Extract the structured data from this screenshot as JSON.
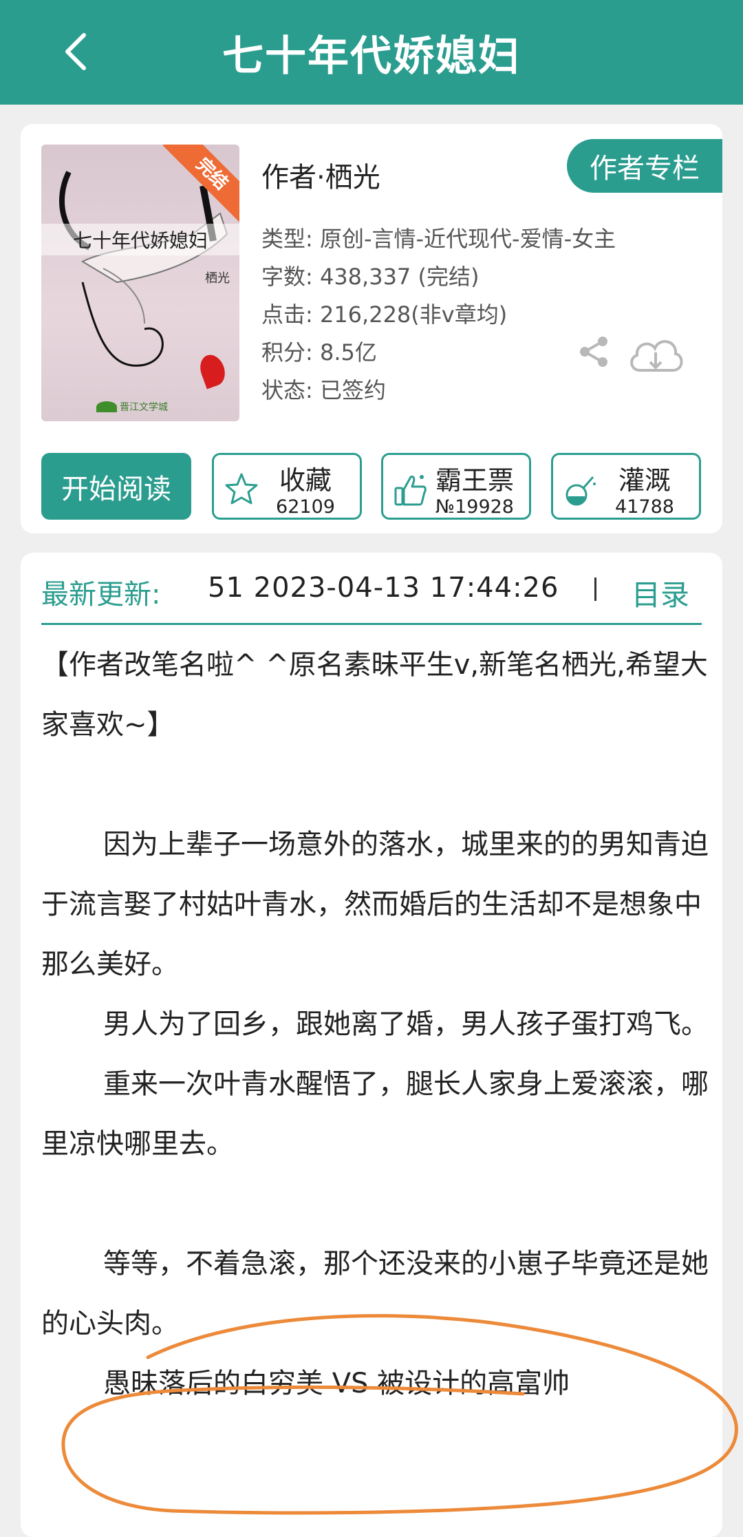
{
  "header": {
    "title": "七十年代娇媳妇",
    "back_icon": "chevron-left-icon"
  },
  "book": {
    "cover": {
      "ribbon": "完结",
      "title": "七十年代娇媳妇",
      "author": "栖光",
      "publisher_logo": "晋江文学城"
    },
    "author_line": "作者·栖光",
    "author_column_button": "作者专栏",
    "meta": {
      "genre": "类型: 原创-言情-近代现代-爱情-女主",
      "word_count": "字数: 438,337 (完结)",
      "clicks": "点击: 216,228(非v章均)",
      "score": "积分: 8.5亿",
      "status": "状态: 已签约"
    },
    "icons": {
      "share": "share-icon",
      "download": "cloud-download-icon"
    }
  },
  "actions": {
    "read": "开始阅读",
    "collect": {
      "label": "收藏",
      "count": "62109",
      "icon": "star-icon"
    },
    "vote": {
      "label": "霸王票",
      "count": "№19928",
      "icon": "thumbs-up-icon"
    },
    "water": {
      "label": "灌溉",
      "count": "41788",
      "icon": "flask-icon"
    }
  },
  "update": {
    "label": "最新更新:",
    "text": "51  2023-04-13 17:44:26",
    "toc": "目录"
  },
  "description": {
    "p1": "【作者改笔名啦^ ^原名素昧平生v,新笔名栖光,希望大家喜欢~】",
    "p2": "因为上辈子一场意外的落水，城里来的的男知青迫于流言娶了村姑叶青水，然而婚后的生活却不是想象中那么美好。",
    "p3": "男人为了回乡，跟她离了婚，男人孩子蛋打鸡飞。",
    "p4": "重来一次叶青水醒悟了，腿长人家身上爱滚滚，哪里凉快哪里去。",
    "p5": "等等，不着急滚，那个还没来的小崽子毕竟还是她的心头肉。",
    "p6": "愚昧落后的白穷美 VS 被设计的高富帅"
  },
  "colors": {
    "accent": "#2a9d8f",
    "annotation": "#ec8a3a",
    "ribbon": "#ee6b36"
  }
}
